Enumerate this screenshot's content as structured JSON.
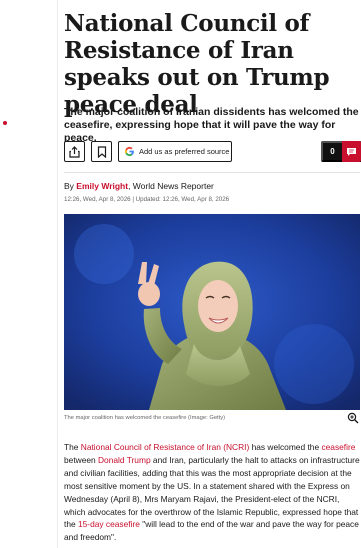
{
  "article": {
    "headline": "National Council of Resistance of Iran speaks out on Trump peace deal",
    "standfirst": "The major coalition of Iranian dissidents has welcomed the ceasefire, expressing hope that it will pave the way for peace.",
    "byline": {
      "prefix": "By ",
      "author": "Emily Wright",
      "role": ", World News Reporter"
    },
    "dates": "12:26, Wed, Apr 8, 2026 | Updated: 12:26, Wed, Apr 8, 2026",
    "image_caption": "The major coalition has welcomed the ceasefire (Image: Getty)",
    "body": [
      {
        "text": "The ",
        "link": false
      },
      {
        "text": "National Council of Resistance of Iran (NCRI)",
        "link": true
      },
      {
        "text": " has welcomed the ",
        "link": false
      },
      {
        "text": "ceasefire",
        "link": true
      },
      {
        "text": " between ",
        "link": false
      },
      {
        "text": "Donald Trump",
        "link": true
      },
      {
        "text": " and Iran, particularly the halt to attacks on infrastructure and civilian facilities, adding that this was the most appropriate decision at the most sensitive moment by the US. In a statement shared with the Express on Wednesday (April 8), Mrs Maryam Rajavi, the President-elect of the NCRI, which advocates for the overthrow of the Islamic Republic, expressed hope that the ",
        "link": false
      },
      {
        "text": "15-day ceasefire",
        "link": true
      },
      {
        "text": " \"will lead to the end of the war and pave the way for peace and freedom\".",
        "link": false
      }
    ]
  },
  "toolbar": {
    "share_icon": "share-icon",
    "bookmark_icon": "bookmark-icon",
    "preferred_source_label": "Add us as preferred source",
    "google_icon": "G",
    "comments_count": "0",
    "comments_icon": "comment-bubble-icon"
  },
  "colors": {
    "accent_red": "#c8102e",
    "text": "#1a1a1a",
    "muted": "#666666",
    "image_bg": "#1d3c8f"
  }
}
